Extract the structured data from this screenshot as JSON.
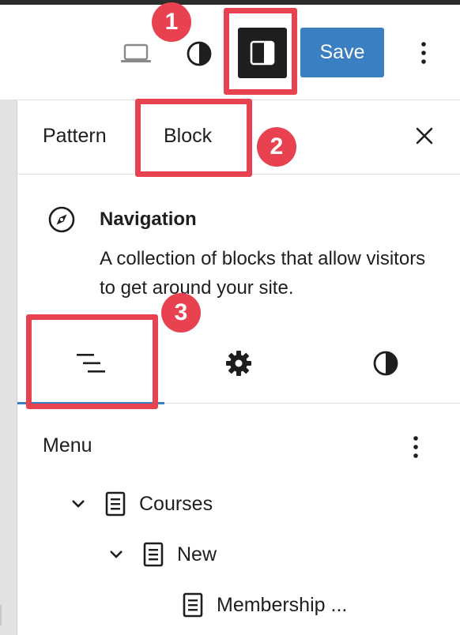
{
  "header": {
    "save_label": "Save"
  },
  "annotations": {
    "badge_1": "1",
    "badge_2": "2",
    "badge_3": "3"
  },
  "sidebar": {
    "tabs": [
      {
        "label": "Pattern"
      },
      {
        "label": "Block"
      }
    ],
    "block": {
      "title": "Navigation",
      "description": "A collection of blocks that allow visitors to get around your site."
    },
    "menu": {
      "label": "Menu",
      "items": [
        {
          "label": "Courses"
        },
        {
          "label": "New"
        },
        {
          "label": "Membership ..."
        }
      ]
    }
  },
  "colors": {
    "accent": "#3a7fc1",
    "annotation_red": "#e84250",
    "dark": "#1e1e1e"
  }
}
